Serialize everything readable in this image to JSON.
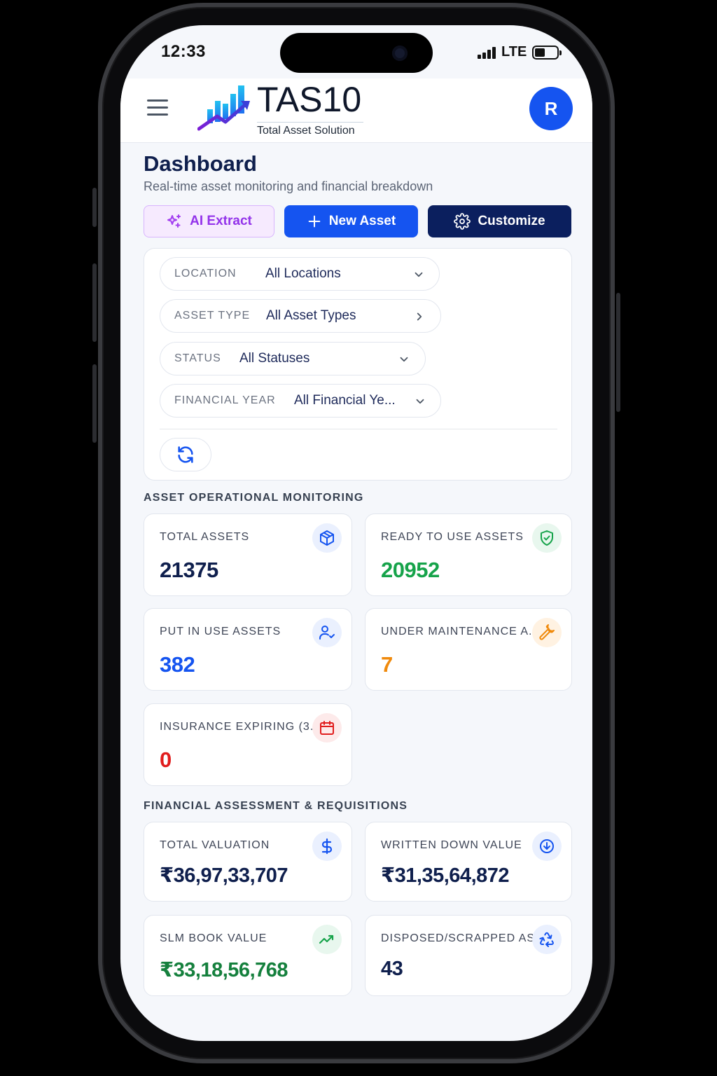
{
  "status_bar": {
    "time": "12:33",
    "network": "LTE"
  },
  "header": {
    "brand_title": "TAS10",
    "brand_subtitle": "Total Asset Solution",
    "avatar_initial": "R"
  },
  "page": {
    "title": "Dashboard",
    "subtitle": "Real-time asset monitoring and financial breakdown"
  },
  "actions": {
    "ai_extract": "AI Extract",
    "new_asset": "New Asset",
    "customize": "Customize"
  },
  "filters": [
    {
      "label": "LOCATION",
      "value": "All Locations",
      "chevron": "chevron-down-icon"
    },
    {
      "label": "ASSET TYPE",
      "value": "All Asset Types",
      "chevron": "chevron-right-icon"
    },
    {
      "label": "STATUS",
      "value": "All Statuses",
      "chevron": "chevron-down-icon"
    },
    {
      "label": "FINANCIAL YEAR",
      "value": "All Financial Ye...",
      "chevron": "chevron-down-icon"
    }
  ],
  "operational": {
    "section_title": "ASSET OPERATIONAL MONITORING",
    "cards": [
      {
        "label": "TOTAL ASSETS",
        "value": "21375",
        "color": "#0f1f4d",
        "icon": "cube-icon",
        "icon_color": "#1554f0",
        "icon_bg": "#eaf0fe"
      },
      {
        "label": "READY TO USE ASSETS",
        "value": "20952",
        "color": "#16a34a",
        "icon": "shield-check-icon",
        "icon_color": "#16a34a",
        "icon_bg": "#e8f7ee"
      },
      {
        "label": "PUT IN USE ASSETS",
        "value": "382",
        "color": "#1554f0",
        "icon": "user-check-icon",
        "icon_color": "#1554f0",
        "icon_bg": "#eaf0fe"
      },
      {
        "label": "UNDER MAINTENANCE A...",
        "value": "7",
        "color": "#f08a0c",
        "icon": "wrench-icon",
        "icon_color": "#f08a0c",
        "icon_bg": "#fff2e2"
      },
      {
        "label": "INSURANCE EXPIRING (3...",
        "value": "0",
        "color": "#e11d1d",
        "icon": "calendar-icon",
        "icon_color": "#e11d1d",
        "icon_bg": "#fdeaea"
      }
    ]
  },
  "financial": {
    "section_title": "FINANCIAL ASSESSMENT & REQUISITIONS",
    "cards": [
      {
        "label": "TOTAL VALUATION",
        "value": "₹36,97,33,707",
        "color": "#0f1f4d",
        "icon": "dollar-icon",
        "icon_color": "#1554f0",
        "icon_bg": "#eaf0fe"
      },
      {
        "label": "WRITTEN DOWN VALUE",
        "value": "₹31,35,64,872",
        "color": "#0f1f4d",
        "icon": "arrow-down-circle-icon",
        "icon_color": "#1554f0",
        "icon_bg": "#eaf0fe"
      },
      {
        "label": "SLM BOOK VALUE",
        "value": "₹33,18,56,768",
        "color": "#15803d",
        "icon": "trending-up-icon",
        "icon_color": "#16a34a",
        "icon_bg": "#e8f7ee"
      },
      {
        "label": "DISPOSED/SCRAPPED AS...",
        "value": "43",
        "color": "#0f1f4d",
        "icon": "recycle-icon",
        "icon_color": "#1554f0",
        "icon_bg": "#eaf0fe"
      }
    ]
  }
}
